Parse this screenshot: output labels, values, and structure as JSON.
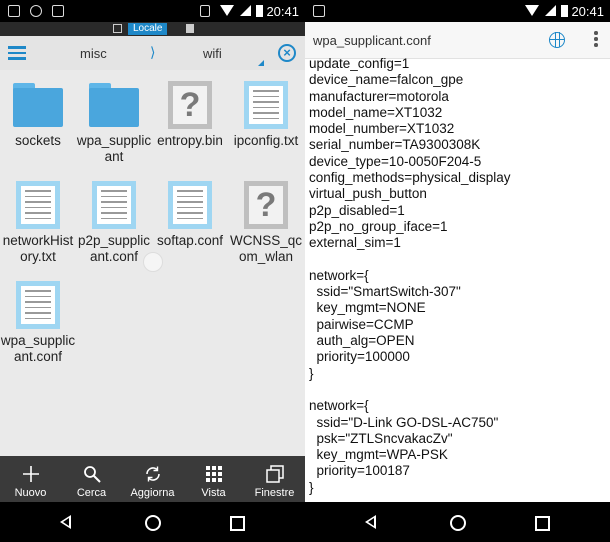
{
  "left": {
    "status": {
      "time": "20:41"
    },
    "header": {
      "locale_chip": "Locale",
      "breadcrumb": [
        "misc",
        "wifi"
      ],
      "separator": "⟩"
    },
    "files": [
      {
        "name": "sockets",
        "kind": "folder"
      },
      {
        "name": "wpa_supplicant",
        "kind": "folder"
      },
      {
        "name": "entropy.bin",
        "kind": "unknown"
      },
      {
        "name": "ipconfig.txt",
        "kind": "text"
      },
      {
        "name": "networkHistory.txt",
        "kind": "text"
      },
      {
        "name": "p2p_supplicant.conf",
        "kind": "text"
      },
      {
        "name": "softap.conf",
        "kind": "text"
      },
      {
        "name": "WCNSS_qcom_wlan",
        "kind": "unknown"
      },
      {
        "name": "wpa_supplicant.conf",
        "kind": "text"
      }
    ],
    "toolbar": [
      {
        "label": "Nuovo",
        "icon": "plus-icon"
      },
      {
        "label": "Cerca",
        "icon": "search-icon"
      },
      {
        "label": "Aggiorna",
        "icon": "refresh-icon"
      },
      {
        "label": "Vista",
        "icon": "grid-icon"
      },
      {
        "label": "Finestre",
        "icon": "windows-icon"
      }
    ]
  },
  "right": {
    "status": {
      "time": "20:41"
    },
    "header": {
      "title": "wpa_supplicant.conf"
    },
    "file_text": "update_config=1\ndevice_name=falcon_gpe\nmanufacturer=motorola\nmodel_name=XT1032\nmodel_number=XT1032\nserial_number=TA9300308K\ndevice_type=10-0050F204-5\nconfig_methods=physical_display\nvirtual_push_button\np2p_disabled=1\np2p_no_group_iface=1\nexternal_sim=1\n\nnetwork={\n  ssid=\"SmartSwitch-307\"\n  key_mgmt=NONE\n  pairwise=CCMP\n  auth_alg=OPEN\n  priority=100000\n}\n\nnetwork={\n  ssid=\"D-Link GO-DSL-AC750\"\n  psk=\"ZTLSncvakacZv\"\n  key_mgmt=WPA-PSK\n  priority=100187\n}"
  },
  "colors": {
    "accent": "#1e88c8",
    "toolbar": "#3a3a3a",
    "folder": "#4aa6dd"
  }
}
